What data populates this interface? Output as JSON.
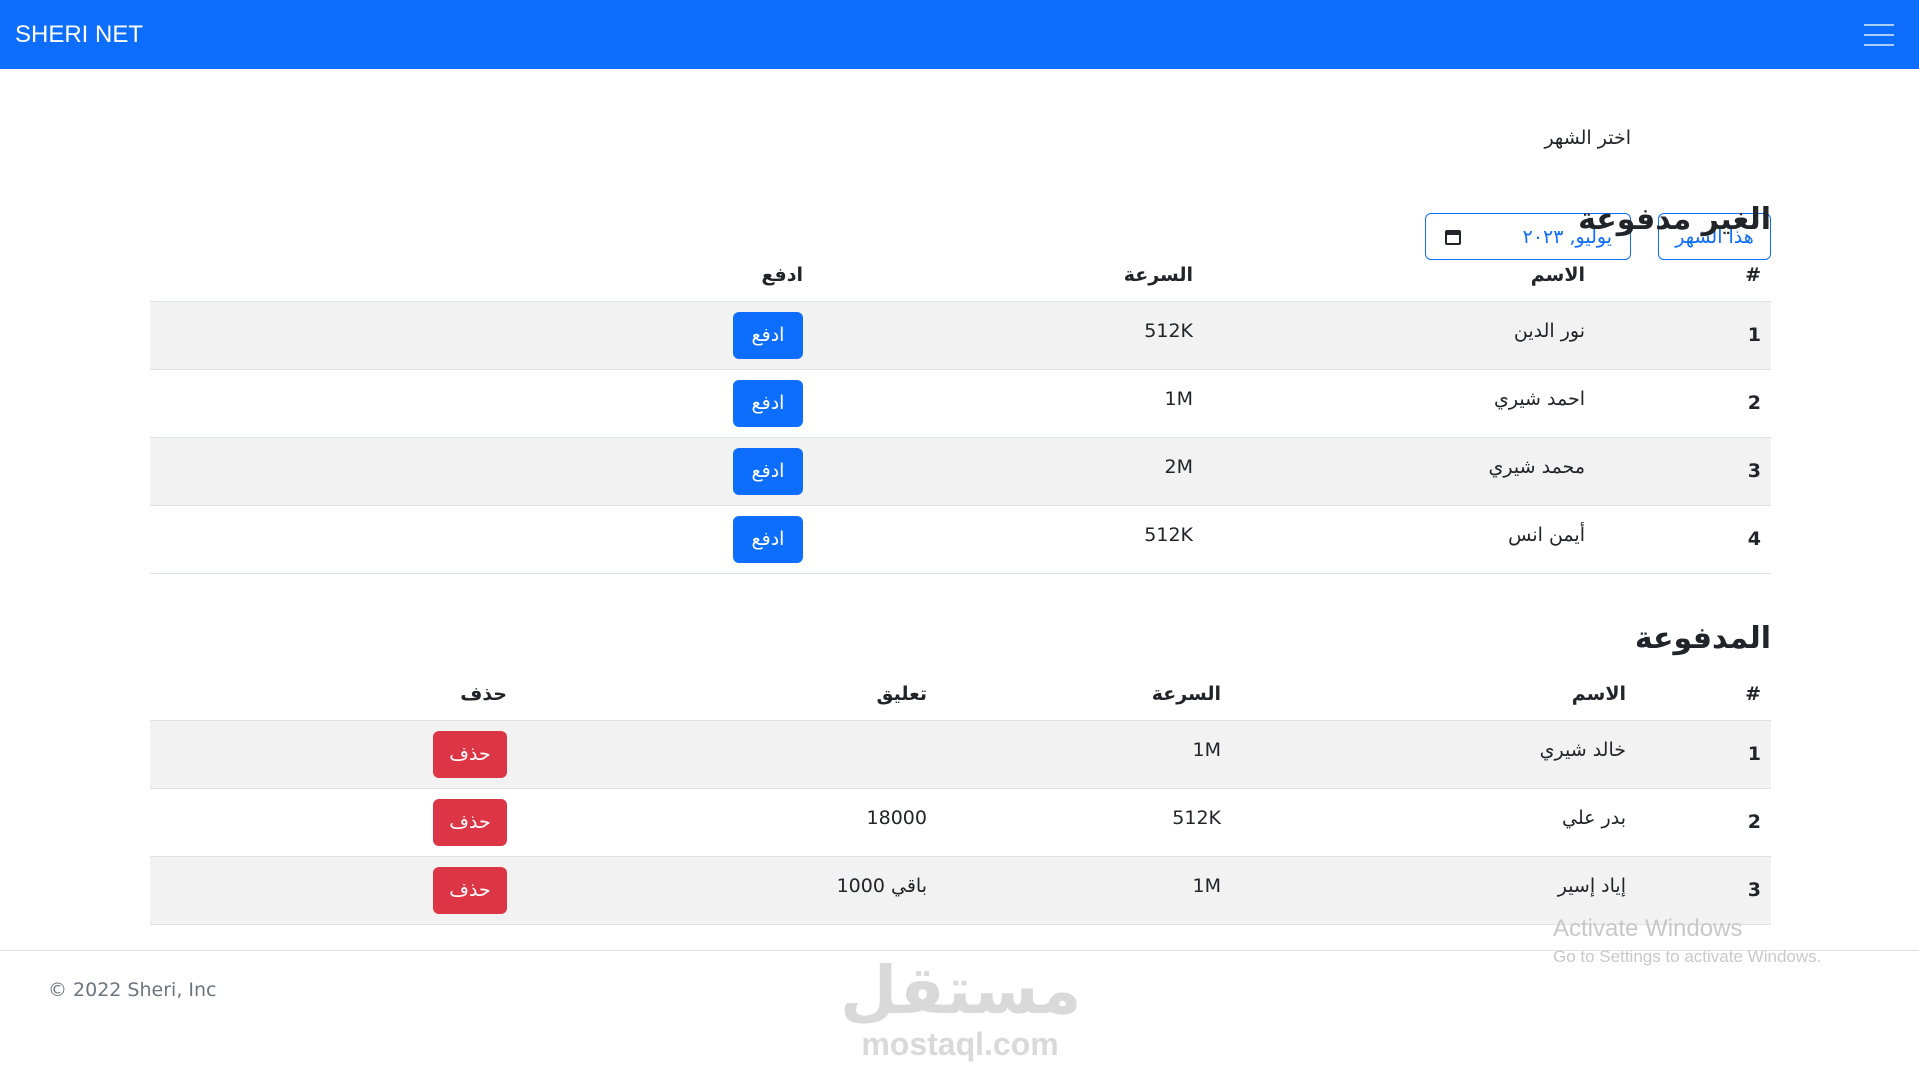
{
  "navbar": {
    "brand": "SHERI NET",
    "menu_icon": "hamburger-menu-icon"
  },
  "month_picker": {
    "label": "اختر الشهر",
    "value": "يوليو, ٢٠٢٣",
    "this_month_button": "هذا الشهر",
    "calendar_icon": "calendar-icon"
  },
  "unpaid": {
    "title": "الغير مدفوعة",
    "headers": {
      "num": "#",
      "name": "الاسم",
      "speed": "السرعة",
      "action": "ادفع"
    },
    "rows": [
      {
        "num": "1",
        "name": "نور الدين",
        "speed": "512K",
        "action": "ادفع"
      },
      {
        "num": "2",
        "name": "احمد شيري",
        "speed": "1M",
        "action": "ادفع"
      },
      {
        "num": "3",
        "name": "محمد شيري",
        "speed": "2M",
        "action": "ادفع"
      },
      {
        "num": "4",
        "name": "أيمن انس",
        "speed": "512K",
        "action": "ادفع"
      }
    ]
  },
  "paid": {
    "title": "المدفوعة",
    "headers": {
      "num": "#",
      "name": "الاسم",
      "speed": "السرعة",
      "comment": "تعليق",
      "action": "حذف"
    },
    "rows": [
      {
        "num": "1",
        "name": "خالد شيري",
        "speed": "1M",
        "comment": "",
        "action": "حذف"
      },
      {
        "num": "2",
        "name": "بدر علي",
        "speed": "512K",
        "comment": "18000",
        "action": "حذف"
      },
      {
        "num": "3",
        "name": "إياد إسير",
        "speed": "1M",
        "comment": "باقي 1000",
        "action": "حذف"
      }
    ]
  },
  "footer": {
    "copyright": "© 2022 Sheri, Inc"
  },
  "watermark": {
    "arabic": "مستقل",
    "latin": "mostaql.com"
  },
  "os_overlay": {
    "line1": "Activate Windows",
    "line2": "Go to Settings to activate Windows."
  },
  "colors": {
    "primary": "#0d6efd",
    "danger": "#dc3545",
    "stripe": "#f2f2f2"
  }
}
